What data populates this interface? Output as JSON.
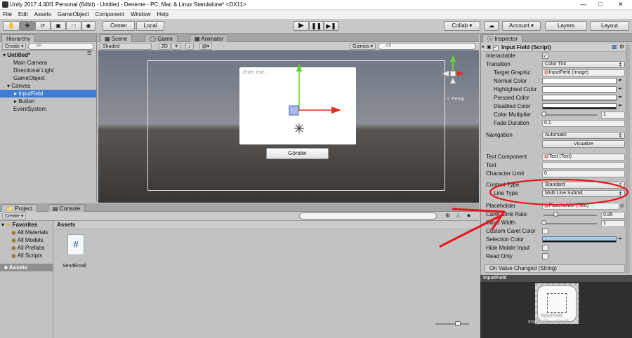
{
  "window": {
    "title": "Unity 2017.4.40f1 Personal (64bit) - Untitled - Deneme - PC, Mac & Linux Standalone* <DX11>",
    "controls": [
      "—",
      "□",
      "✕"
    ]
  },
  "menu": [
    "File",
    "Edit",
    "Assets",
    "GameObject",
    "Component",
    "Window",
    "Help"
  ],
  "toolbar": {
    "center_label": "Center",
    "local_label": "Local",
    "collab_label": "Collab ▾",
    "account_label": "Account ▾",
    "layers_label": "Layers",
    "layout_label": "Layout"
  },
  "hierarchy": {
    "tab": "Hierarchy",
    "create": "Create ▾",
    "search_placeholder": "All",
    "scene": "Untitled*",
    "items": [
      "Main Camera",
      "Directional Light",
      "GameObject",
      "Canvas",
      "InputField",
      "Button",
      "EventSystem"
    ]
  },
  "scene": {
    "tabs": [
      "Scene",
      "Game",
      "Animator"
    ],
    "shaded": "Shaded",
    "mode2d": "2D",
    "gizmos": "Gizmos ▾",
    "search_placeholder": "All",
    "input_placeholder": "Enter text...",
    "button_label": "Gönder",
    "persp_label": "< Persp"
  },
  "project": {
    "tabs": [
      "Project",
      "Console"
    ],
    "create": "Create ▾",
    "favorites_label": "Favorites",
    "favorites": [
      "All Materials",
      "All Models",
      "All Prefabs",
      "All Scripts"
    ],
    "assets_tree": "Assets",
    "assets_header": "Assets",
    "files": [
      {
        "name": "SendEmail",
        "icon": "csharp-script-icon"
      }
    ]
  },
  "inspector": {
    "tab": "Inspector",
    "component": "Input Field (Script)",
    "rows": {
      "interactable": "Interactable",
      "transition": "Transition",
      "transition_value": "Color Tint",
      "target_graphic": "Target Graphic",
      "target_graphic_value": "InputField (Image)",
      "normal_color": "Normal Color",
      "highlighted_color": "Highlighted Color",
      "pressed_color": "Pressed Color",
      "disabled_color": "Disabled Color",
      "color_multiplier": "Color Multiplier",
      "color_multiplier_value": "1",
      "fade_duration": "Fade Duration",
      "fade_duration_value": "0.1",
      "navigation": "Navigation",
      "navigation_value": "Automatic",
      "visualize": "Visualize",
      "text_component": "Text Component",
      "text_component_value": "Text (Text)",
      "text": "Text",
      "character_limit": "Character Limit",
      "character_limit_value": "0",
      "content_type": "Content Type",
      "content_type_value": "Standard",
      "line_type": "Line Type",
      "line_type_value": "Multi Line Submit",
      "placeholder": "Placeholder",
      "placeholder_value": "Placeholder (Text)",
      "caret_blink_rate": "Caret Blink Rate",
      "caret_blink_rate_value": "0.85",
      "caret_width": "Caret Width",
      "caret_width_value": "1",
      "custom_caret_color": "Custom Caret Color",
      "selection_color": "Selection Color",
      "hide_mobile_input": "Hide Mobile Input",
      "read_only": "Read Only",
      "on_value_changed": "On Value Changed (String)"
    },
    "preview_title": "InputField",
    "preview_caption_1": "InputField",
    "preview_caption_2": "Image Size: 32x32"
  },
  "colors": {
    "selection_blue": "#3d7bd6",
    "annotation_red": "#e8141c",
    "selection_color_swatch": "#a9cdf2"
  }
}
